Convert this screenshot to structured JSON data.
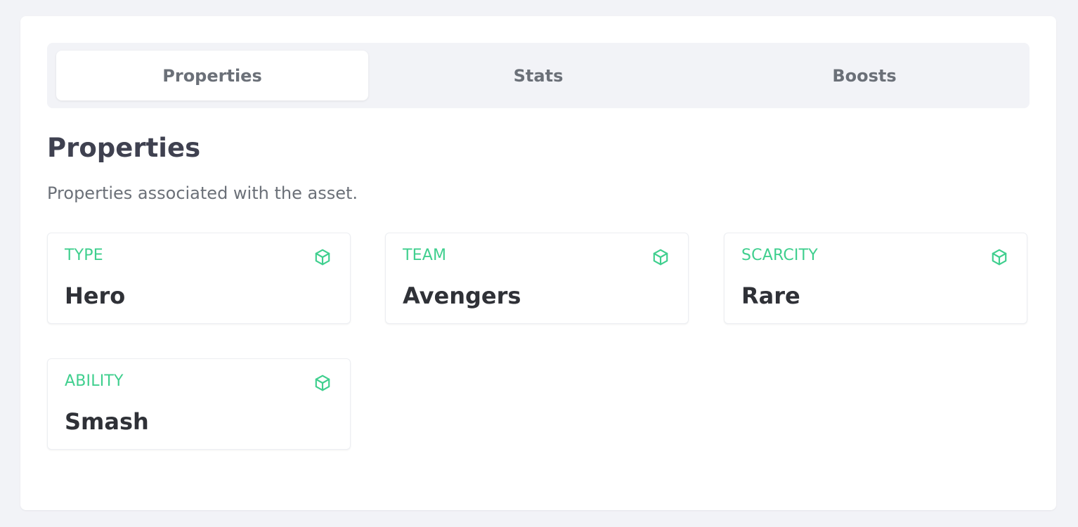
{
  "tabs": [
    {
      "label": "Properties",
      "active": true
    },
    {
      "label": "Stats",
      "active": false
    },
    {
      "label": "Boosts",
      "active": false
    }
  ],
  "section": {
    "title": "Properties",
    "description": "Properties associated with the asset."
  },
  "properties": [
    {
      "label": "TYPE",
      "value": "Hero",
      "icon": "cube-icon"
    },
    {
      "label": "TEAM",
      "value": "Avengers",
      "icon": "cube-icon"
    },
    {
      "label": "SCARCITY",
      "value": "Rare",
      "icon": "cube-icon"
    },
    {
      "label": "ABILITY",
      "value": "Smash",
      "icon": "cube-icon"
    }
  ],
  "colors": {
    "accent": "#3fcf8e",
    "background": "#f2f3f7",
    "text_muted": "#6b7078",
    "text_dark": "#2f3137"
  }
}
